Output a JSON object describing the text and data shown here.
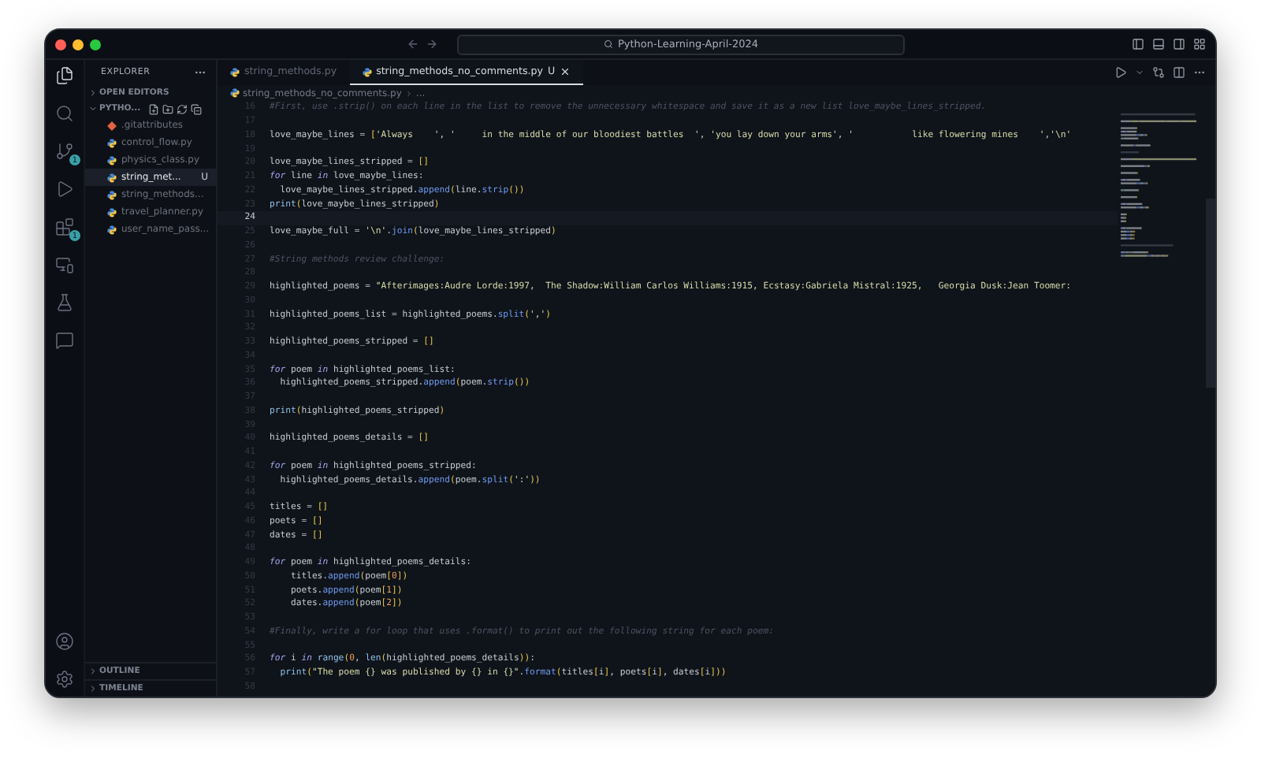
{
  "window": {
    "title": "Python-Learning-April-2024"
  },
  "activity_bar": {
    "top": [
      {
        "kind": "files",
        "selected": true
      },
      {
        "kind": "search",
        "selected": false
      },
      {
        "kind": "source-control",
        "selected": false,
        "badge": "1"
      },
      {
        "kind": "run",
        "selected": false
      },
      {
        "kind": "extensions",
        "selected": false,
        "badge": "1"
      },
      {
        "kind": "remote",
        "selected": false
      },
      {
        "kind": "testing",
        "selected": false
      },
      {
        "kind": "chat",
        "selected": false
      }
    ],
    "bottom": [
      {
        "kind": "account",
        "selected": false
      },
      {
        "kind": "settings",
        "selected": false
      }
    ]
  },
  "sidebar": {
    "title": "EXPLORER",
    "open_editors": {
      "label": "OPEN EDITORS",
      "expanded": false
    },
    "folder": {
      "label": "PYTHO...",
      "expanded": true,
      "files": [
        {
          "name": ".gitattributes",
          "kind": "git",
          "selected": false
        },
        {
          "name": "control_flow.py",
          "kind": "python",
          "selected": false
        },
        {
          "name": "physics_class.py",
          "kind": "python",
          "selected": false
        },
        {
          "name": "string_met...",
          "kind": "python",
          "selected": true,
          "badge": "U"
        },
        {
          "name": "string_methods...",
          "kind": "python",
          "selected": false
        },
        {
          "name": "travel_planner.py",
          "kind": "python",
          "selected": false
        },
        {
          "name": "user_name_pass...",
          "kind": "python",
          "selected": false
        }
      ]
    },
    "bottom_sections": [
      {
        "label": "OUTLINE",
        "expanded": false
      },
      {
        "label": "TIMELINE",
        "expanded": false
      }
    ]
  },
  "tabs": [
    {
      "label": "string_methods.py",
      "selected": false
    },
    {
      "label": "string_methods_no_comments.py",
      "selected": true,
      "badge": "U"
    }
  ],
  "breadcrumb": [
    "string_methods_no_comments.py",
    "..."
  ],
  "editor": {
    "lines": [
      {
        "n": "16",
        "current": false,
        "tokens": [
          {
            "text": "#First, use .strip() on each line in the list to remove the unnecessary whitespace and save it as a new list love_maybe_lines_stripped.",
            "kind": "comment"
          }
        ]
      },
      {
        "n": "17",
        "current": false
      },
      {
        "n": "18",
        "current": false,
        "tokens": [
          {
            "text": "love_maybe_lines = ",
            "kind": "plain"
          },
          {
            "text": "[",
            "kind": "bracket"
          },
          {
            "text": "'Always    '",
            "kind": "string"
          },
          {
            "text": ", ",
            "kind": "plain"
          },
          {
            "text": "'     in the middle of our bloodiest battles  '",
            "kind": "string"
          },
          {
            "text": ", ",
            "kind": "plain"
          },
          {
            "text": "'you lay down your arms'",
            "kind": "string"
          },
          {
            "text": ", ",
            "kind": "plain"
          },
          {
            "text": "'           like flowering mines    '",
            "kind": "string"
          },
          {
            "text": ",",
            "kind": "plain"
          },
          {
            "text": "'\\n'",
            "kind": "string"
          }
        ]
      },
      {
        "n": "19",
        "current": false
      },
      {
        "n": "20",
        "current": false,
        "tokens": [
          {
            "text": "love_maybe_lines_stripped = ",
            "kind": "plain"
          },
          {
            "text": "[]",
            "kind": "bracket"
          }
        ]
      },
      {
        "n": "21",
        "current": false,
        "tokens": [
          {
            "text": "for",
            "kind": "keyword"
          },
          {
            "text": " line ",
            "kind": "plain"
          },
          {
            "text": "in",
            "kind": "keyword"
          },
          {
            "text": " love_maybe_lines:",
            "kind": "plain"
          }
        ]
      },
      {
        "n": "22",
        "current": false,
        "tokens": [
          {
            "text": "  love_maybe_lines_stripped.",
            "kind": "plain"
          },
          {
            "text": "append",
            "kind": "method"
          },
          {
            "text": "(",
            "kind": "bracket"
          },
          {
            "text": "line.",
            "kind": "plain"
          },
          {
            "text": "strip",
            "kind": "method"
          },
          {
            "text": "())",
            "kind": "bracket"
          }
        ]
      },
      {
        "n": "23",
        "current": false,
        "tokens": [
          {
            "text": "print",
            "kind": "builtin"
          },
          {
            "text": "(",
            "kind": "bracket"
          },
          {
            "text": "love_maybe_lines_stripped",
            "kind": "plain"
          },
          {
            "text": ")",
            "kind": "bracket"
          }
        ]
      },
      {
        "n": "24",
        "current": true
      },
      {
        "n": "25",
        "current": false,
        "tokens": [
          {
            "text": "love_maybe_full = ",
            "kind": "plain"
          },
          {
            "text": "'\\n'",
            "kind": "string"
          },
          {
            "text": ".",
            "kind": "plain"
          },
          {
            "text": "join",
            "kind": "method"
          },
          {
            "text": "(",
            "kind": "bracket"
          },
          {
            "text": "love_maybe_lines_stripped",
            "kind": "plain"
          },
          {
            "text": ")",
            "kind": "bracket"
          }
        ]
      },
      {
        "n": "26",
        "current": false
      },
      {
        "n": "27",
        "current": false,
        "tokens": [
          {
            "text": "#String methods review challenge:",
            "kind": "comment"
          }
        ]
      },
      {
        "n": "28",
        "current": false
      },
      {
        "n": "29",
        "current": false,
        "tokens": [
          {
            "text": "highlighted_poems = ",
            "kind": "plain"
          },
          {
            "text": "\"Afterimages:Audre Lorde:1997,  The Shadow:William Carlos Williams:1915, Ecstasy:Gabriela Mistral:1925,   Georgia Dusk:Jean Toomer:",
            "kind": "string"
          }
        ]
      },
      {
        "n": "30",
        "current": false
      },
      {
        "n": "31",
        "current": false,
        "tokens": [
          {
            "text": "highlighted_poems_list = highlighted_poems.",
            "kind": "plain"
          },
          {
            "text": "split",
            "kind": "method"
          },
          {
            "text": "(",
            "kind": "bracket"
          },
          {
            "text": "','",
            "kind": "string"
          },
          {
            "text": ")",
            "kind": "bracket"
          }
        ]
      },
      {
        "n": "32",
        "current": false
      },
      {
        "n": "33",
        "current": false,
        "tokens": [
          {
            "text": "highlighted_poems_stripped = ",
            "kind": "plain"
          },
          {
            "text": "[]",
            "kind": "bracket"
          }
        ]
      },
      {
        "n": "34",
        "current": false
      },
      {
        "n": "35",
        "current": false,
        "tokens": [
          {
            "text": "for",
            "kind": "keyword"
          },
          {
            "text": " poem ",
            "kind": "plain"
          },
          {
            "text": "in",
            "kind": "keyword"
          },
          {
            "text": " highlighted_poems_list:",
            "kind": "plain"
          }
        ]
      },
      {
        "n": "36",
        "current": false,
        "tokens": [
          {
            "text": "  highlighted_poems_stripped.",
            "kind": "plain"
          },
          {
            "text": "append",
            "kind": "method"
          },
          {
            "text": "(",
            "kind": "bracket"
          },
          {
            "text": "poem.",
            "kind": "plain"
          },
          {
            "text": "strip",
            "kind": "method"
          },
          {
            "text": "())",
            "kind": "bracket"
          }
        ]
      },
      {
        "n": "37",
        "current": false
      },
      {
        "n": "38",
        "current": false,
        "tokens": [
          {
            "text": "print",
            "kind": "builtin"
          },
          {
            "text": "(",
            "kind": "bracket"
          },
          {
            "text": "highlighted_poems_stripped",
            "kind": "plain"
          },
          {
            "text": ")",
            "kind": "bracket"
          }
        ]
      },
      {
        "n": "39",
        "current": false
      },
      {
        "n": "40",
        "current": false,
        "tokens": [
          {
            "text": "highlighted_poems_details = ",
            "kind": "plain"
          },
          {
            "text": "[]",
            "kind": "bracket"
          }
        ]
      },
      {
        "n": "41",
        "current": false
      },
      {
        "n": "42",
        "current": false,
        "tokens": [
          {
            "text": "for",
            "kind": "keyword"
          },
          {
            "text": " poem ",
            "kind": "plain"
          },
          {
            "text": "in",
            "kind": "keyword"
          },
          {
            "text": " highlighted_poems_stripped:",
            "kind": "plain"
          }
        ]
      },
      {
        "n": "43",
        "current": false,
        "tokens": [
          {
            "text": "  highlighted_poems_details.",
            "kind": "plain"
          },
          {
            "text": "append",
            "kind": "method"
          },
          {
            "text": "(",
            "kind": "bracket"
          },
          {
            "text": "poem.",
            "kind": "plain"
          },
          {
            "text": "split",
            "kind": "method"
          },
          {
            "text": "(",
            "kind": "bracket"
          },
          {
            "text": "':'",
            "kind": "string"
          },
          {
            "text": "))",
            "kind": "bracket"
          }
        ]
      },
      {
        "n": "44",
        "current": false
      },
      {
        "n": "45",
        "current": false,
        "tokens": [
          {
            "text": "titles = ",
            "kind": "plain"
          },
          {
            "text": "[]",
            "kind": "bracket"
          }
        ]
      },
      {
        "n": "46",
        "current": false,
        "tokens": [
          {
            "text": "poets = ",
            "kind": "plain"
          },
          {
            "text": "[]",
            "kind": "bracket"
          }
        ]
      },
      {
        "n": "47",
        "current": false,
        "tokens": [
          {
            "text": "dates = ",
            "kind": "plain"
          },
          {
            "text": "[]",
            "kind": "bracket"
          }
        ]
      },
      {
        "n": "48",
        "current": false
      },
      {
        "n": "49",
        "current": false,
        "tokens": [
          {
            "text": "for",
            "kind": "keyword"
          },
          {
            "text": " poem ",
            "kind": "plain"
          },
          {
            "text": "in",
            "kind": "keyword"
          },
          {
            "text": " highlighted_poems_details:",
            "kind": "plain"
          }
        ]
      },
      {
        "n": "50",
        "current": false,
        "tokens": [
          {
            "text": "    titles.",
            "kind": "plain"
          },
          {
            "text": "append",
            "kind": "method"
          },
          {
            "text": "(",
            "kind": "bracket"
          },
          {
            "text": "poem",
            "kind": "plain"
          },
          {
            "text": "[",
            "kind": "bracket"
          },
          {
            "text": "0",
            "kind": "number"
          },
          {
            "text": "])",
            "kind": "bracket"
          }
        ]
      },
      {
        "n": "51",
        "current": false,
        "tokens": [
          {
            "text": "    poets.",
            "kind": "plain"
          },
          {
            "text": "append",
            "kind": "method"
          },
          {
            "text": "(",
            "kind": "bracket"
          },
          {
            "text": "poem",
            "kind": "plain"
          },
          {
            "text": "[",
            "kind": "bracket"
          },
          {
            "text": "1",
            "kind": "number"
          },
          {
            "text": "])",
            "kind": "bracket"
          }
        ]
      },
      {
        "n": "52",
        "current": false,
        "tokens": [
          {
            "text": "    dates.",
            "kind": "plain"
          },
          {
            "text": "append",
            "kind": "method"
          },
          {
            "text": "(",
            "kind": "bracket"
          },
          {
            "text": "poem",
            "kind": "plain"
          },
          {
            "text": "[",
            "kind": "bracket"
          },
          {
            "text": "2",
            "kind": "number"
          },
          {
            "text": "])",
            "kind": "bracket"
          }
        ]
      },
      {
        "n": "53",
        "current": false
      },
      {
        "n": "54",
        "current": false,
        "tokens": [
          {
            "text": "#Finally, write a for loop that uses .format() to print out the following string for each poem:",
            "kind": "comment"
          }
        ]
      },
      {
        "n": "55",
        "current": false
      },
      {
        "n": "56",
        "current": false,
        "tokens": [
          {
            "text": "for",
            "kind": "keyword"
          },
          {
            "text": " i ",
            "kind": "plain"
          },
          {
            "text": "in",
            "kind": "keyword"
          },
          {
            "text": " range",
            "kind": "builtin"
          },
          {
            "text": "(",
            "kind": "bracket"
          },
          {
            "text": "0",
            "kind": "number"
          },
          {
            "text": ", ",
            "kind": "plain"
          },
          {
            "text": "len",
            "kind": "builtin"
          },
          {
            "text": "(",
            "kind": "bracket"
          },
          {
            "text": "highlighted_poems_details",
            "kind": "plain"
          },
          {
            "text": "))",
            "kind": "bracket"
          },
          {
            "text": ":",
            "kind": "plain"
          }
        ]
      },
      {
        "n": "57",
        "current": false,
        "tokens": [
          {
            "text": "  print",
            "kind": "builtin"
          },
          {
            "text": "(",
            "kind": "bracket"
          },
          {
            "text": "\"The poem {} was published by {} in {}\"",
            "kind": "string"
          },
          {
            "text": ".",
            "kind": "plain"
          },
          {
            "text": "format",
            "kind": "method"
          },
          {
            "text": "(",
            "kind": "bracket"
          },
          {
            "text": "titles",
            "kind": "plain"
          },
          {
            "text": "[",
            "kind": "bracket"
          },
          {
            "text": "i",
            "kind": "plain"
          },
          {
            "text": "]",
            "kind": "bracket"
          },
          {
            "text": ", poets",
            "kind": "plain"
          },
          {
            "text": "[",
            "kind": "bracket"
          },
          {
            "text": "i",
            "kind": "plain"
          },
          {
            "text": "]",
            "kind": "bracket"
          },
          {
            "text": ", dates",
            "kind": "plain"
          },
          {
            "text": "[",
            "kind": "bracket"
          },
          {
            "text": "i",
            "kind": "plain"
          },
          {
            "text": "]))",
            "kind": "bracket"
          }
        ]
      },
      {
        "n": "58",
        "current": false
      }
    ]
  }
}
